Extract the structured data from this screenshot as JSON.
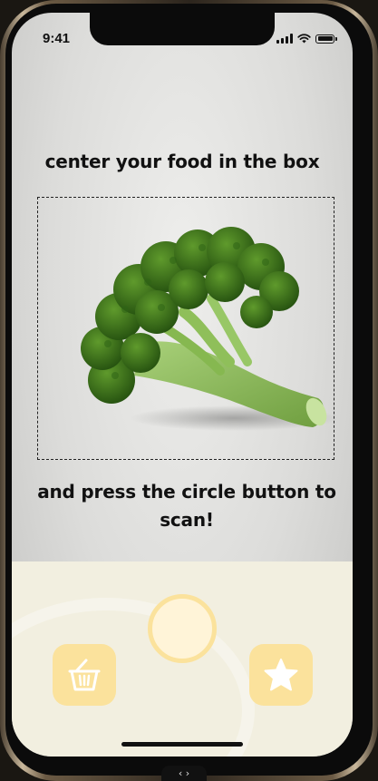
{
  "status_bar": {
    "time": "9:41",
    "icons": [
      "signal-icon",
      "wifi-icon",
      "battery-icon"
    ]
  },
  "scanner": {
    "instruction_top": "center your food in the box",
    "instruction_bottom": "and press the circle button to scan!",
    "subject_image": "broccoli"
  },
  "bottom_nav": {
    "left_icon": "basket-icon",
    "right_icon": "star-icon",
    "center_control": "scan-circle-button"
  },
  "colors": {
    "accent": "#fbe29c",
    "accent_light": "#fff4d8",
    "panel": "#f2efe0",
    "text": "#111111",
    "screen_bg": "#dcdcda"
  }
}
